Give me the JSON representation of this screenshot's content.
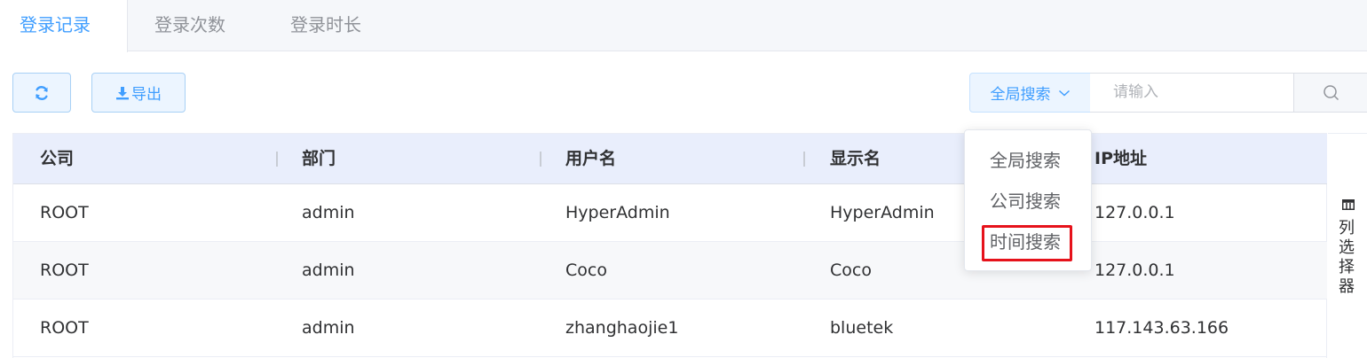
{
  "tabs": [
    {
      "label": "登录记录",
      "active": true
    },
    {
      "label": "登录次数",
      "active": false
    },
    {
      "label": "登录时长",
      "active": false
    }
  ],
  "toolbar": {
    "refresh_icon": "refresh-icon",
    "export_label": "导出",
    "export_icon": "download-icon"
  },
  "search": {
    "scope_label": "全局搜索",
    "placeholder": "请输入",
    "search_icon": "search-icon"
  },
  "table": {
    "columns": [
      "公司",
      "部门",
      "用户名",
      "显示名",
      "IP地址"
    ],
    "rows": [
      [
        "ROOT",
        "admin",
        "HyperAdmin",
        "HyperAdmin",
        "127.0.0.1"
      ],
      [
        "ROOT",
        "admin",
        "Coco",
        "Coco",
        "127.0.0.1"
      ],
      [
        "ROOT",
        "admin",
        "zhanghaojie1",
        "bluetek",
        "117.143.63.166"
      ]
    ]
  },
  "column_chooser": {
    "label": "列选择器",
    "icon": "columns-icon"
  },
  "dropdown": {
    "options": [
      "全局搜索",
      "公司搜索",
      "时间搜索"
    ],
    "highlighted": "时间搜索"
  },
  "colors": {
    "accent": "#409eff",
    "header_bg": "#e9eefc",
    "highlight": "#e6121b"
  }
}
